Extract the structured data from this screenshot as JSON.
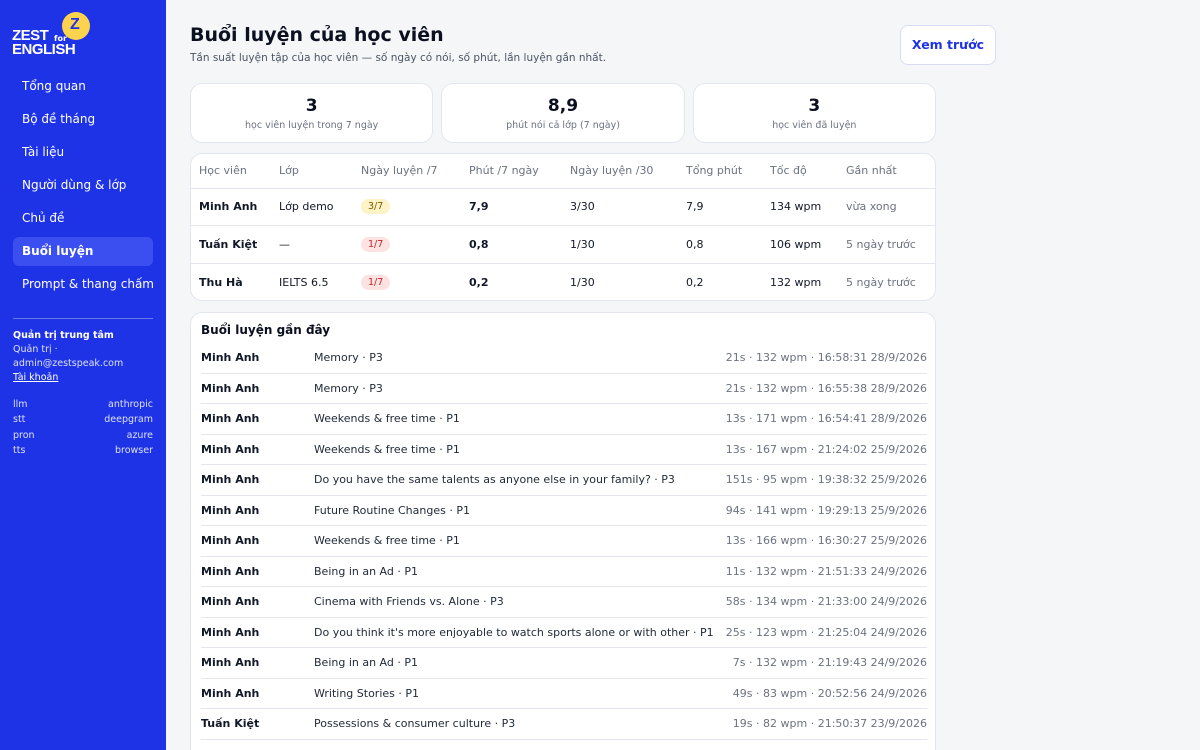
{
  "brand": {
    "zest": "ZEST",
    "for": "for",
    "english": "ENGLISH",
    "mark": "Z"
  },
  "sidebar": {
    "items": [
      {
        "label": "Tổng quan"
      },
      {
        "label": "Bộ đề tháng"
      },
      {
        "label": "Tài liệu"
      },
      {
        "label": "Người dùng & lớp"
      },
      {
        "label": "Chủ đề"
      },
      {
        "label": "Buổi luyện",
        "active": true
      },
      {
        "label": "Prompt & thang chấm"
      }
    ],
    "account": {
      "title": "Quản trị trung tâm",
      "role": "Quản trị ·",
      "email": "admin@zestspeak.com",
      "link": "Tài khoản"
    },
    "providers": [
      {
        "key": "llm",
        "value": "anthropic"
      },
      {
        "key": "stt",
        "value": "deepgram"
      },
      {
        "key": "pron",
        "value": "azure"
      },
      {
        "key": "tts",
        "value": "browser"
      }
    ]
  },
  "header": {
    "title": "Buổi luyện của học viên",
    "subtitle": "Tần suất luyện tập của học viên — số ngày có nói, số phút, lần luyện gần nhất.",
    "preview_label": "Xem trước"
  },
  "stats": [
    {
      "value": "3",
      "label": "học viên luyện trong 7 ngày"
    },
    {
      "value": "8,9",
      "label": "phút nói cả lớp (7 ngày)"
    },
    {
      "value": "3",
      "label": "học viên đã luyện"
    }
  ],
  "table": {
    "headers": [
      "Học viên",
      "Lớp",
      "Ngày luyện /7",
      "Phút /7 ngày",
      "Ngày luyện /30",
      "Tổng phút",
      "Tốc độ",
      "Gần nhất"
    ],
    "rows": [
      {
        "name": "Minh Anh",
        "class": "Lớp demo",
        "days7": "3/7",
        "days7_status": "yellow",
        "min7": "7,9",
        "days30": "3/30",
        "total": "7,9",
        "speed": "134 wpm",
        "last": "vừa xong"
      },
      {
        "name": "Tuấn Kiệt",
        "class": "—",
        "days7": "1/7",
        "days7_status": "red",
        "min7": "0,8",
        "days30": "1/30",
        "total": "0,8",
        "speed": "106 wpm",
        "last": "5 ngày trước"
      },
      {
        "name": "Thu Hà",
        "class": "IELTS 6.5",
        "days7": "1/7",
        "days7_status": "red",
        "min7": "0,2",
        "days30": "1/30",
        "total": "0,2",
        "speed": "132 wpm",
        "last": "5 ngày trước"
      }
    ]
  },
  "recent": {
    "title": "Buổi luyện gần đây",
    "rows": [
      {
        "name": "Minh Anh",
        "topic": "Memory · P3",
        "meta": "21s · 132 wpm · 16:58:31 28/9/2026"
      },
      {
        "name": "Minh Anh",
        "topic": "Memory · P3",
        "meta": "21s · 132 wpm · 16:55:38 28/9/2026"
      },
      {
        "name": "Minh Anh",
        "topic": "Weekends & free time · P1",
        "meta": "13s · 171 wpm · 16:54:41 28/9/2026"
      },
      {
        "name": "Minh Anh",
        "topic": "Weekends & free time · P1",
        "meta": "13s · 167 wpm · 21:24:02 25/9/2026"
      },
      {
        "name": "Minh Anh",
        "topic": "Do you have the same talents as anyone else in your family? · P3",
        "meta": "151s · 95 wpm · 19:38:32 25/9/2026"
      },
      {
        "name": "Minh Anh",
        "topic": "Future Routine Changes · P1",
        "meta": "94s · 141 wpm · 19:29:13 25/9/2026"
      },
      {
        "name": "Minh Anh",
        "topic": "Weekends & free time · P1",
        "meta": "13s · 166 wpm · 16:30:27 25/9/2026"
      },
      {
        "name": "Minh Anh",
        "topic": "Being in an Ad · P1",
        "meta": "11s · 132 wpm · 21:51:33 24/9/2026"
      },
      {
        "name": "Minh Anh",
        "topic": "Cinema with Friends vs. Alone · P3",
        "meta": "58s · 134 wpm · 21:33:00 24/9/2026"
      },
      {
        "name": "Minh Anh",
        "topic": "Do you think it's more enjoyable to watch sports alone or with other · P1",
        "meta": "25s · 123 wpm · 21:25:04 24/9/2026"
      },
      {
        "name": "Minh Anh",
        "topic": "Being in an Ad · P1",
        "meta": "7s · 132 wpm · 21:19:43 24/9/2026"
      },
      {
        "name": "Minh Anh",
        "topic": "Writing Stories · P1",
        "meta": "49s · 83 wpm · 20:52:56 24/9/2026"
      },
      {
        "name": "Tuấn Kiệt",
        "topic": "Possessions & consumer culture · P3",
        "meta": "19s · 82 wpm · 21:50:37 23/9/2026"
      }
    ]
  }
}
